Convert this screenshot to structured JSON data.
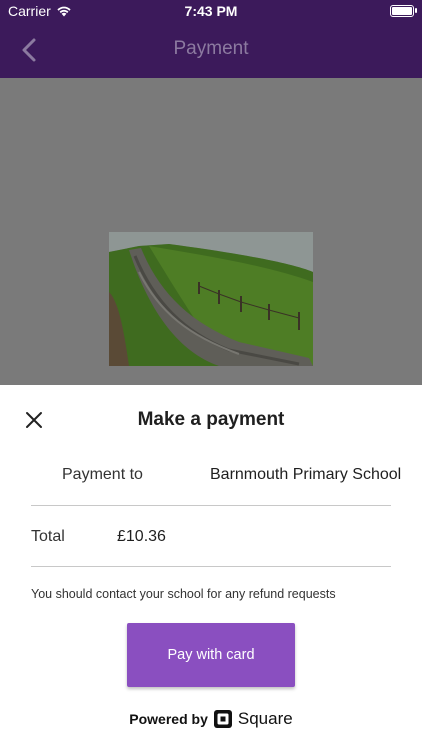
{
  "status_bar": {
    "carrier": "Carrier",
    "time": "7:43 PM"
  },
  "nav": {
    "title": "Payment",
    "back_icon": "chevron-left-icon"
  },
  "sheet": {
    "title": "Make a payment",
    "close_icon": "close-icon",
    "payment_to_label": "Payment to",
    "payment_to_value": "Barnmouth Primary School",
    "total_label": "Total",
    "total_value": "£10.36",
    "note": "You should contact your school for any refund requests",
    "pay_button": "Pay with card",
    "powered_by": "Powered by",
    "square_text": "Square"
  },
  "colors": {
    "nav_bg": "#3c1a5b",
    "overlay": "#7a7a7a",
    "button": "#8a4fc0"
  }
}
